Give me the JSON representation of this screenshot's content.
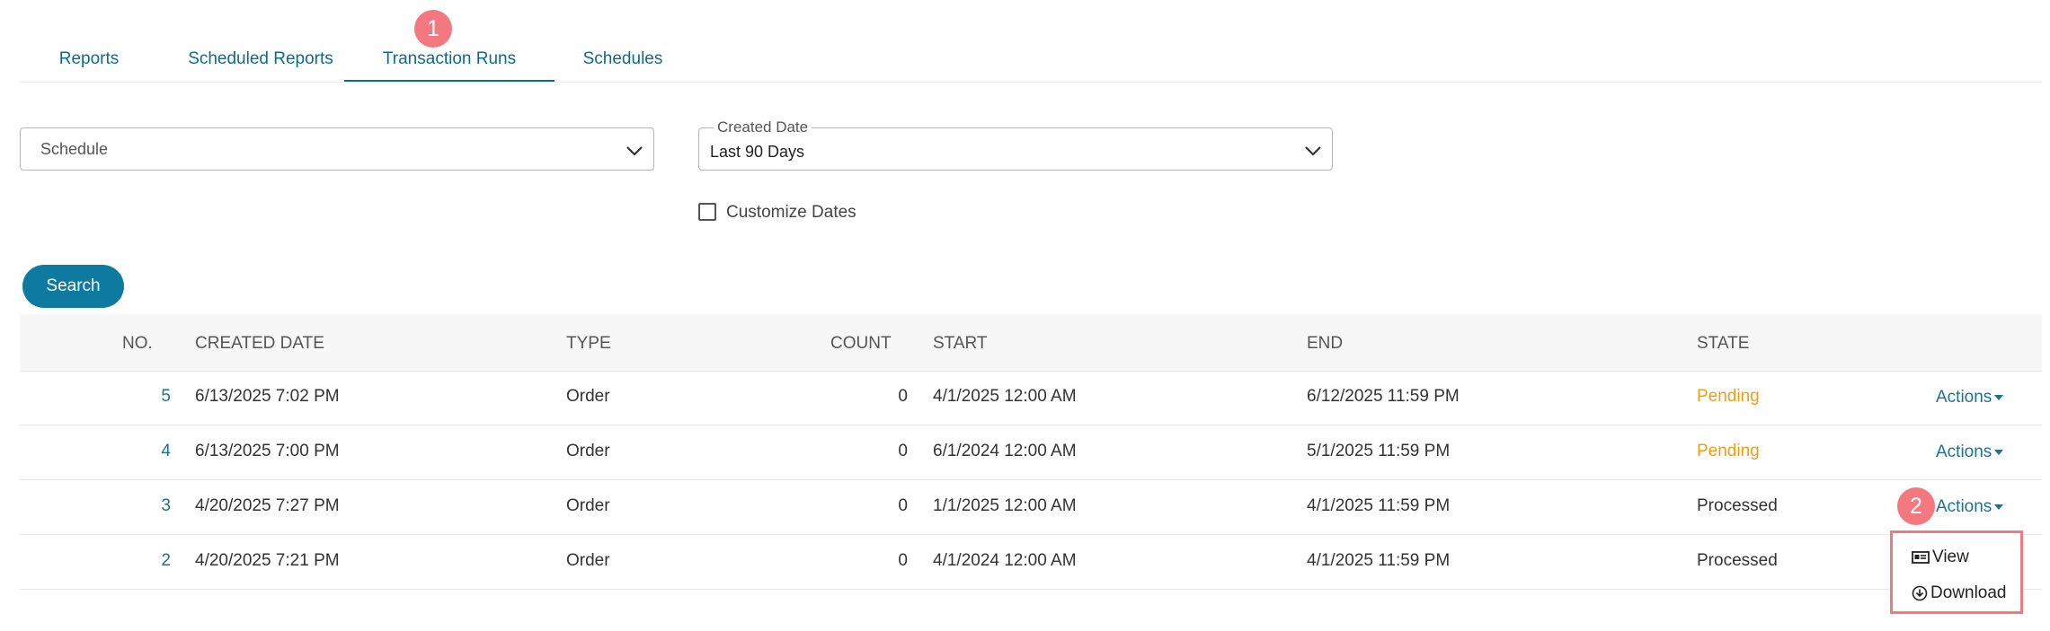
{
  "tabs": [
    {
      "label": "Reports",
      "active": false
    },
    {
      "label": "Scheduled Reports",
      "active": false
    },
    {
      "label": "Transaction Runs",
      "active": true
    },
    {
      "label": "Schedules",
      "active": false
    }
  ],
  "annotations": {
    "badge_1": "1",
    "badge_2": "2",
    "badge_color": "#f4787f"
  },
  "filters": {
    "schedule": {
      "placeholder": "Schedule"
    },
    "created_date": {
      "legend": "Created Date",
      "value": "Last 90 Days"
    },
    "customize_dates": {
      "label": "Customize Dates",
      "checked": false
    }
  },
  "search_button": {
    "label": "Search"
  },
  "table": {
    "headers": {
      "no": "NO.",
      "created_date": "CREATED DATE",
      "type": "TYPE",
      "count": "COUNT",
      "start": "START",
      "end": "END",
      "state": "STATE"
    },
    "rows": [
      {
        "no": "5",
        "created_date": "6/13/2025 7:02 PM",
        "type": "Order",
        "count": "0",
        "start": "4/1/2025 12:00 AM",
        "end": "6/12/2025 11:59 PM",
        "state": "Pending",
        "action": "Actions"
      },
      {
        "no": "4",
        "created_date": "6/13/2025 7:00 PM",
        "type": "Order",
        "count": "0",
        "start": "6/1/2024 12:00 AM",
        "end": "5/1/2025 11:59 PM",
        "state": "Pending",
        "action": "Actions"
      },
      {
        "no": "3",
        "created_date": "4/20/2025 7:27 PM",
        "type": "Order",
        "count": "0",
        "start": "1/1/2025 12:00 AM",
        "end": "4/1/2025 11:59 PM",
        "state": "Processed",
        "action": "Actions"
      },
      {
        "no": "2",
        "created_date": "4/20/2025 7:21 PM",
        "type": "Order",
        "count": "0",
        "start": "4/1/2024 12:00 AM",
        "end": "4/1/2025 11:59 PM",
        "state": "Processed",
        "action": ""
      }
    ]
  },
  "actions_menu": {
    "items": [
      {
        "label": "View",
        "icon": "view-card-icon"
      },
      {
        "label": "Download",
        "icon": "download-circle-icon"
      }
    ]
  },
  "colors": {
    "accent": "#0e6b8b",
    "button": "#0e7aa0",
    "pending": "#f39c12",
    "link": "#1f6f95"
  }
}
